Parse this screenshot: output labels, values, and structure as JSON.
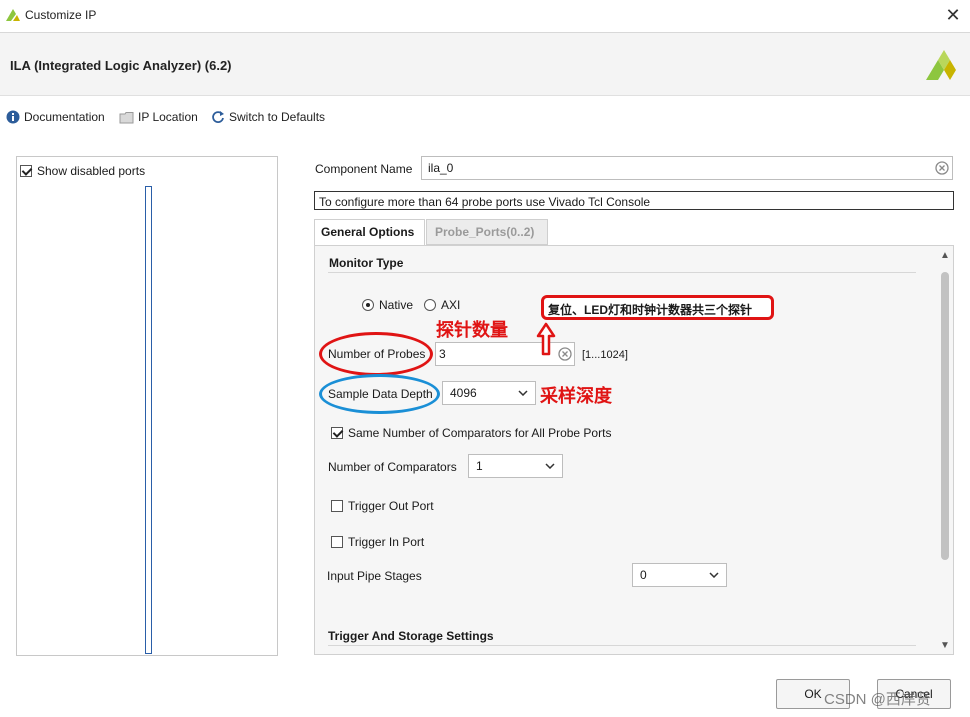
{
  "window": {
    "title": "Customize IP",
    "close_glyph": "✕"
  },
  "header": {
    "ip_title": "ILA (Integrated Logic Analyzer) (6.2)"
  },
  "toolbar": {
    "documentation": "Documentation",
    "ip_location": "IP Location",
    "switch_defaults": "Switch to Defaults"
  },
  "left_panel": {
    "show_disabled_ports": "Show disabled ports",
    "show_disabled_checked": true
  },
  "component": {
    "label": "Component Name",
    "value": "ila_0"
  },
  "note": "To configure more than 64 probe ports use Vivado Tcl Console",
  "tabs": [
    {
      "label": "General Options",
      "active": true
    },
    {
      "label": "Probe_Ports(0..2)",
      "active": false
    }
  ],
  "general": {
    "monitor_type_title": "Monitor Type",
    "monitor_options": [
      {
        "label": "Native",
        "selected": true
      },
      {
        "label": "AXI",
        "selected": false
      }
    ],
    "num_probes_label": "Number of Probes",
    "num_probes_value": "3",
    "num_probes_range": "[1...1024]",
    "sample_depth_label": "Sample Data Depth",
    "sample_depth_value": "4096",
    "same_comparators_label": "Same Number of Comparators for All Probe Ports",
    "same_comparators_checked": true,
    "num_comparators_label": "Number of Comparators",
    "num_comparators_value": "1",
    "trigger_out_label": "Trigger Out Port",
    "trigger_in_label": "Trigger In Port",
    "pipe_stages_label": "Input Pipe Stages",
    "pipe_stages_value": "0",
    "trigger_storage_title": "Trigger And Storage Settings"
  },
  "annotations": {
    "probe_count": "探针数量",
    "sample_depth": "采样深度",
    "probe_note": "复位、LED灯和时钟计数器共三个探针"
  },
  "footer": {
    "ok": "OK",
    "cancel": "Cancel"
  },
  "watermark": "CSDN @西岸贤",
  "colors": {
    "annotation_red": "#e01414",
    "annotation_blue": "#1a8fd6",
    "brand_green": "#8dc63f"
  },
  "icons": {
    "documentation": "info-icon",
    "ip_location": "folder-icon",
    "switch_defaults": "refresh-icon",
    "clear": "clear-circle-icon",
    "dropdown": "chevron-down-icon"
  }
}
